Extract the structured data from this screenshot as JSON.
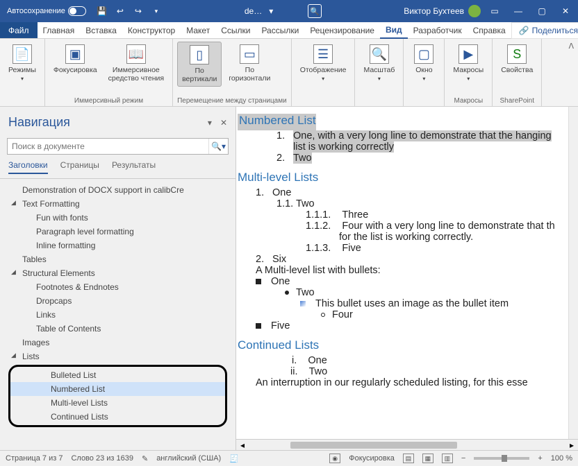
{
  "titlebar": {
    "autosave_label": "Автосохранение",
    "doc_name": "de…",
    "user_name": "Виктор Бухтеев"
  },
  "ribbon_tabs": {
    "file": "Файл",
    "items": [
      "Главная",
      "Вставка",
      "Конструктор",
      "Макет",
      "Ссылки",
      "Рассылки",
      "Рецензирование",
      "Вид",
      "Разработчик",
      "Справка"
    ],
    "active_index": 7,
    "share": "Поделиться"
  },
  "ribbon": {
    "modes": "Режимы",
    "focus": "Фокусировка",
    "immersive_reader_l1": "Иммерсивное",
    "immersive_reader_l2": "средство чтения",
    "group_immersive": "Иммерсивный режим",
    "vertical_l1": "По",
    "vertical_l2": "вертикали",
    "horizontal_l1": "По",
    "horizontal_l2": "горизонтали",
    "group_page_move": "Перемещение между страницами",
    "display": "Отображение",
    "zoom": "Масштаб",
    "window": "Окно",
    "macros": "Макросы",
    "group_macros": "Макросы",
    "properties": "Свойства",
    "group_sharepoint": "SharePoint"
  },
  "nav": {
    "title": "Навигация",
    "search_placeholder": "Поиск в документе",
    "tabs": {
      "headings": "Заголовки",
      "pages": "Страницы",
      "results": "Результаты"
    },
    "tree": {
      "root": "Demonstration of DOCX support in calibCre",
      "text_formatting": "Text Formatting",
      "fun_fonts": "Fun with fonts",
      "para_fmt": "Paragraph level formatting",
      "inline_fmt": "Inline formatting",
      "tables": "Tables",
      "struct": "Structural Elements",
      "footnotes": "Footnotes & Endnotes",
      "dropcaps": "Dropcaps",
      "links": "Links",
      "toc": "Table of Contents",
      "images": "Images",
      "lists": "Lists",
      "bulleted": "Bulleted List",
      "numbered": "Numbered List",
      "multilevel": "Multi-level Lists",
      "continued": "Continued Lists"
    }
  },
  "doc": {
    "h_numbered": "Numbered List",
    "nl_1a": "One, with a very long line to demonstrate that the hanging",
    "nl_1b": "list is working correctly",
    "nl_2": "Two",
    "h_multilevel": "Multi-level Lists",
    "ml_1": "One",
    "ml_11": "Two",
    "ml_111": "Three",
    "ml_112": "Four with a very long line to demonstrate that th",
    "ml_112b": "for the list is working correctly.",
    "ml_113": "Five",
    "ml_2": "Six",
    "ml_bullets_intro": "A Multi-level list with bullets:",
    "mlb_1": "One",
    "mlb_2": "Two",
    "mlb_3": "This bullet uses an image as the bullet item",
    "mlb_4": "Four",
    "mlb_5": "Five",
    "h_continued": "Continued Lists",
    "cl_i": "One",
    "cl_ii": "Two",
    "cl_int": "An interruption in our regularly scheduled listing, for this esse"
  },
  "statusbar": {
    "page": "Страница 7 из 7",
    "words": "Слово 23 из 1639",
    "lang": "английский (США)",
    "focus": "Фокусировка",
    "zoom": "100 %"
  }
}
